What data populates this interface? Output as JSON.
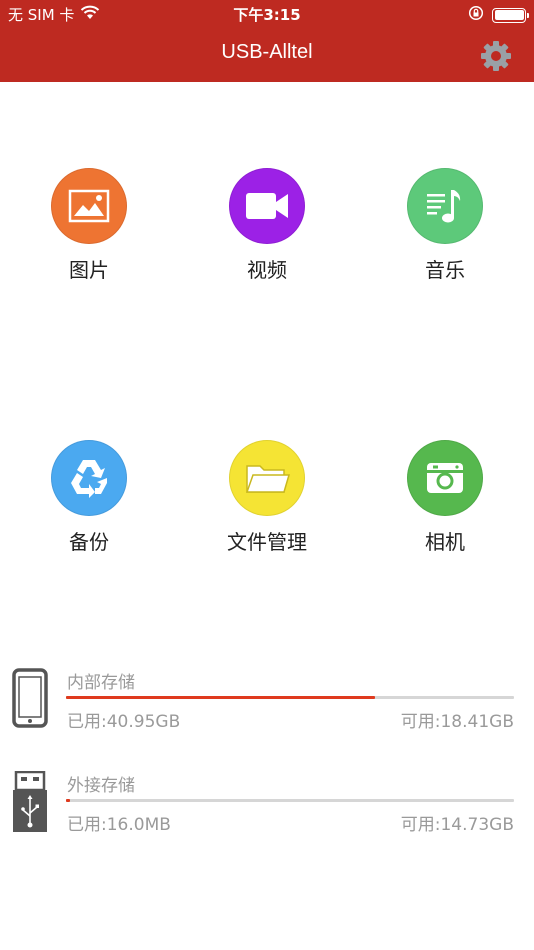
{
  "status_bar": {
    "carrier": "无 SIM 卡",
    "time": "下午3:15"
  },
  "header": {
    "title": "USB-Alltel"
  },
  "grid": [
    {
      "id": "pictures",
      "label": "图片",
      "color": "#EE7432",
      "icon": "image-icon"
    },
    {
      "id": "videos",
      "label": "视频",
      "color": "#9C21E6",
      "icon": "video-camera-icon"
    },
    {
      "id": "music",
      "label": "音乐",
      "color": "#5DC97A",
      "icon": "music-note-icon"
    },
    {
      "id": "backup",
      "label": "备份",
      "color": "#4BA9F0",
      "icon": "recycle-icon"
    },
    {
      "id": "files",
      "label": "文件管理",
      "color": "#F5E434",
      "icon": "folder-icon"
    },
    {
      "id": "camera",
      "label": "相机",
      "color": "#56B84E",
      "icon": "camera-icon"
    }
  ],
  "storage": {
    "internal": {
      "name": "内部存储",
      "used": "已用:40.95GB",
      "available": "可用:18.41GB",
      "fraction_used": 0.69
    },
    "external": {
      "name": "外接存储",
      "used": "已用:16.0MB",
      "available": "可用:14.73GB",
      "fraction_used": 0.01
    }
  }
}
